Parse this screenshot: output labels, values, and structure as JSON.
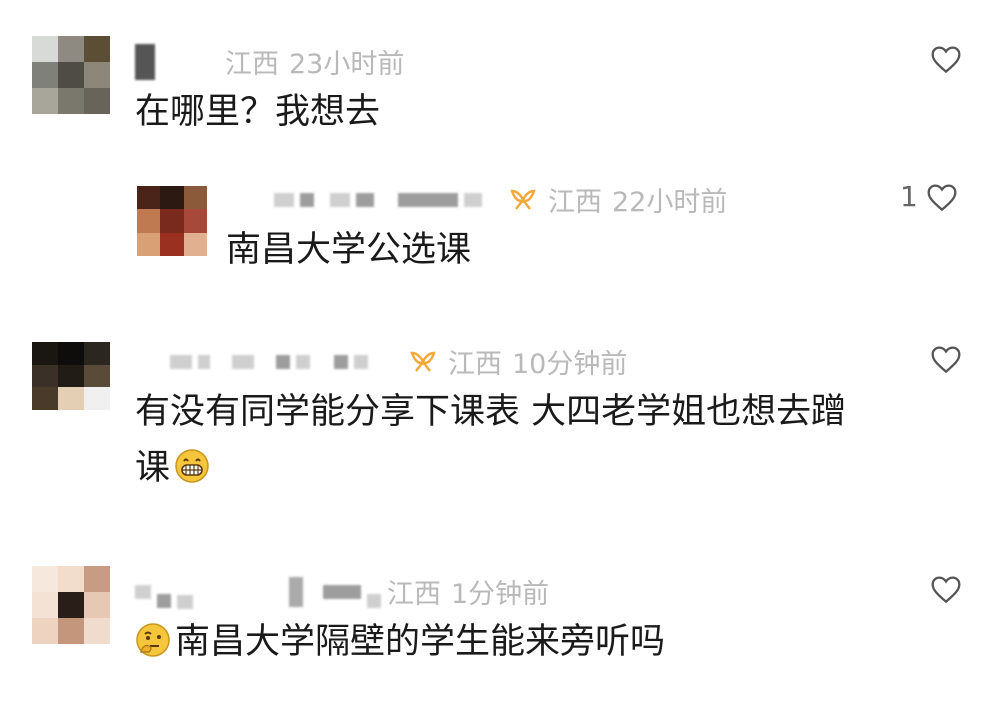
{
  "comments": [
    {
      "location": "江西",
      "time": "23小时前",
      "text": "在哪里？我想去",
      "likes": ""
    },
    {
      "location": "江西",
      "time": "22小时前",
      "text": "南昌大学公选课",
      "likes": "1"
    },
    {
      "location": "江西",
      "time": "10分钟前",
      "text": "有没有同学能分享下课表 大四老学姐也想去蹭",
      "text_line2": "课",
      "likes": ""
    },
    {
      "location": "江西",
      "time": "1分钟前",
      "text": "南昌大学隔壁的学生能来旁听吗",
      "likes": ""
    }
  ],
  "icons": {
    "like": "heart-outline-icon",
    "badge": "orange-ribbon-badge-icon",
    "emoji_grin": "grinning-face-emoji",
    "emoji_think": "thinking-face-emoji"
  },
  "colors": {
    "text": "#1a1a1a",
    "meta": "#b9b9b9",
    "badge": "#f2a93b",
    "emoji": "#f5c53c"
  }
}
